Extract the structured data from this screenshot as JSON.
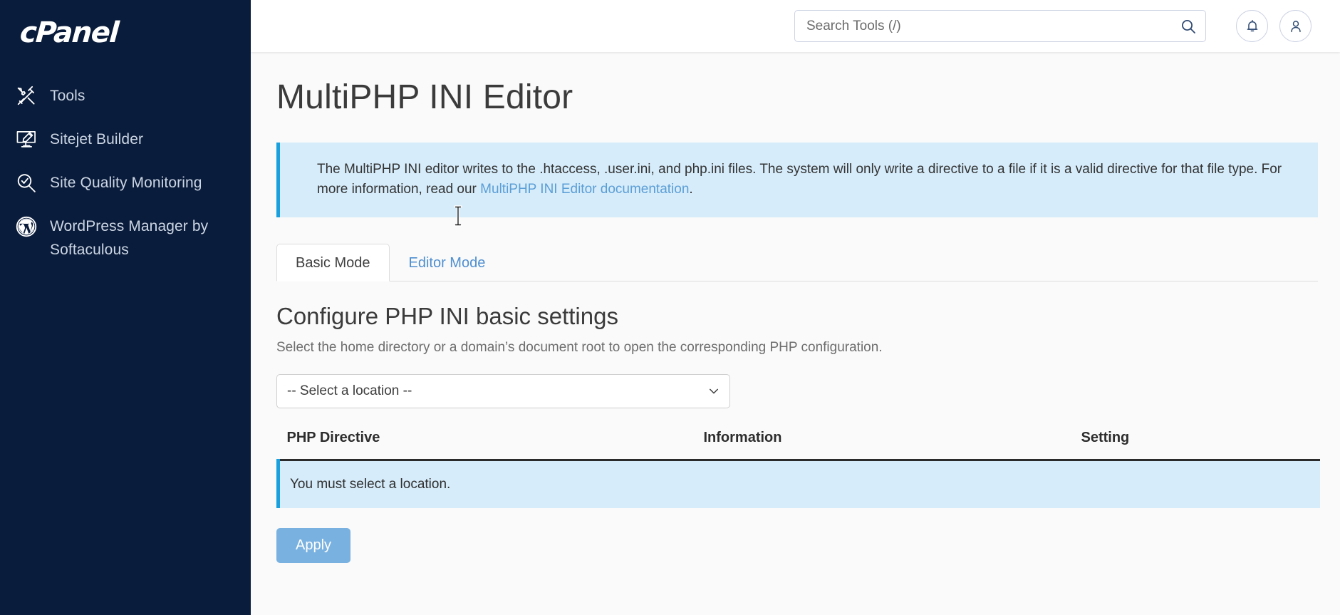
{
  "brand": {
    "logo_text": "cPanel"
  },
  "sidebar": {
    "items": [
      {
        "label": "Tools",
        "icon": "tools-icon"
      },
      {
        "label": "Sitejet Builder",
        "icon": "monitor-pencil-icon"
      },
      {
        "label": "Site Quality Monitoring",
        "icon": "magnifier-check-icon"
      },
      {
        "label": "WordPress Manager by Softaculous",
        "icon": "wordpress-icon"
      }
    ]
  },
  "header": {
    "search_placeholder": "Search Tools (/)",
    "search_value": "",
    "search_icon": "search-icon",
    "notifications_icon": "bell-icon",
    "account_icon": "user-icon"
  },
  "page": {
    "title": "MultiPHP INI Editor"
  },
  "info_banner": {
    "text_part1": "The MultiPHP INI editor writes to the .htaccess, .user.ini, and php.ini files. The system will only write a directive to a file if it is a valid directive for that file type. For more information, read our ",
    "link_text": "MultiPHP INI Editor documentation",
    "text_part2": "."
  },
  "tabs": [
    {
      "label": "Basic Mode",
      "active": true
    },
    {
      "label": "Editor Mode",
      "active": false
    }
  ],
  "section": {
    "title": "Configure PHP INI basic settings",
    "description": "Select the home directory or a domain’s document root to open the corresponding PHP configuration."
  },
  "location_select": {
    "selected": "-- Select a location --",
    "options": [
      "-- Select a location --"
    ],
    "chevron_icon": "chevron-down-icon"
  },
  "table": {
    "headers": [
      "PHP Directive",
      "Information",
      "Setting"
    ],
    "empty_message": "You must select a location."
  },
  "actions": {
    "apply_label": "Apply"
  },
  "colors": {
    "sidebar_bg": "#0a1c3b",
    "info_bg": "#d6ecfa",
    "info_border": "#19a0dd",
    "link": "#5b9ed6",
    "apply_bg": "#79b1e0",
    "content_bg": "#fafafa"
  }
}
